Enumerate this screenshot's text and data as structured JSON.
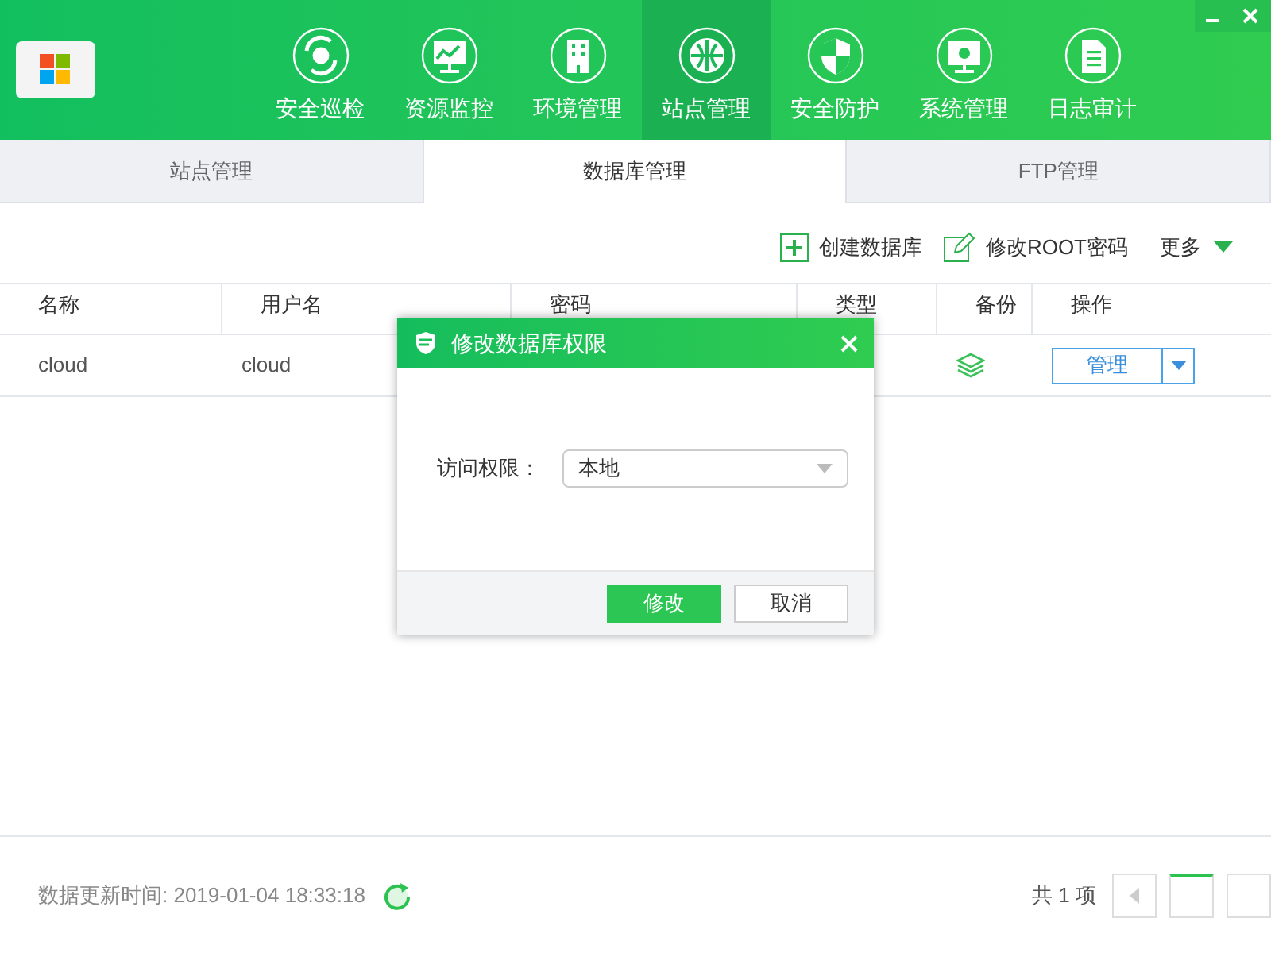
{
  "nav": [
    {
      "label": "安全巡检",
      "kind": "scan",
      "selected": false
    },
    {
      "label": "资源监控",
      "kind": "monitor",
      "selected": false
    },
    {
      "label": "环境管理",
      "kind": "building",
      "selected": false
    },
    {
      "label": "站点管理",
      "kind": "globe",
      "selected": true
    },
    {
      "label": "安全防护",
      "kind": "shield",
      "selected": false
    },
    {
      "label": "系统管理",
      "kind": "system",
      "selected": false
    },
    {
      "label": "日志审计",
      "kind": "log",
      "selected": false
    }
  ],
  "tabs": [
    {
      "label": "站点管理",
      "selected": false
    },
    {
      "label": "数据库管理",
      "selected": true
    },
    {
      "label": "FTP管理",
      "selected": false
    }
  ],
  "toolbar": [
    {
      "label": "创建数据库",
      "kind": "plus"
    },
    {
      "label": "修改ROOT密码",
      "kind": "edit"
    },
    {
      "label": "更多",
      "kind": "more"
    }
  ],
  "table": {
    "columns": [
      "名称",
      "用户名",
      "密码",
      "类型",
      "备份",
      "操作"
    ],
    "rows": [
      {
        "name": "cloud",
        "user": "cloud",
        "action": "管理"
      }
    ]
  },
  "dialog": {
    "title": "修改数据库权限",
    "field_label": "访问权限：",
    "value": "本地",
    "buttons": [
      {
        "label": "修改",
        "kind": "primary"
      },
      {
        "label": "取消",
        "kind": "secondary"
      }
    ]
  },
  "footer": {
    "updated": "数据更新时间: 2019-01-04 18:33:18",
    "total": "共 1 项"
  }
}
